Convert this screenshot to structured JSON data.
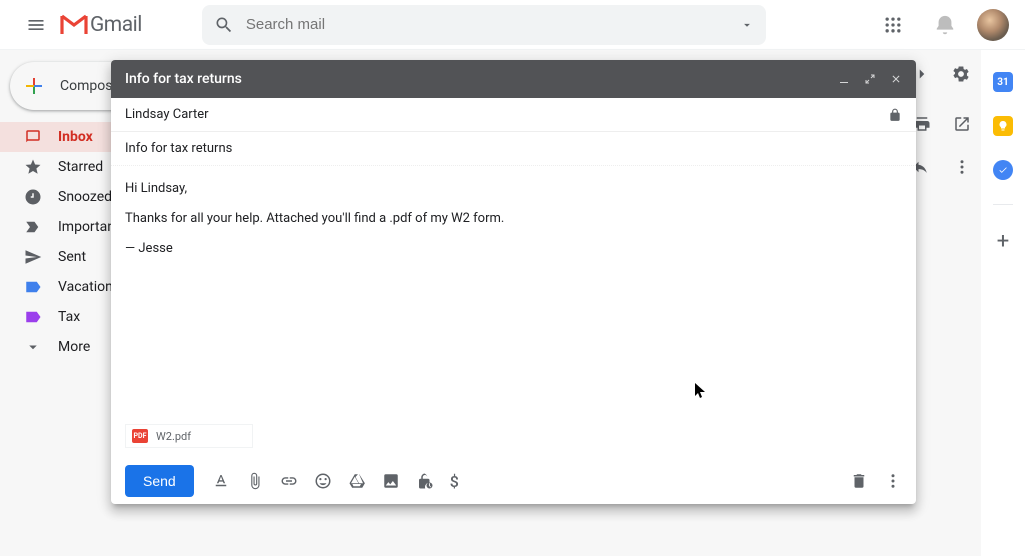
{
  "header": {
    "logo_text": "Gmail",
    "search_placeholder": "Search mail"
  },
  "sidebar": {
    "compose_label": "Compose",
    "items": [
      {
        "label": "Inbox"
      },
      {
        "label": "Starred"
      },
      {
        "label": "Snoozed"
      },
      {
        "label": "Important"
      },
      {
        "label": "Sent"
      },
      {
        "label": "Vacation"
      },
      {
        "label": "Tax"
      },
      {
        "label": "More"
      }
    ]
  },
  "side_panel": {
    "calendar_day": "31"
  },
  "compose": {
    "title": "Info for tax returns",
    "recipient": "Lindsay Carter",
    "subject": "Info for tax returns",
    "body_line1": "Hi Lindsay,",
    "body_line2": "Thanks for all your help. Attached you'll find a .pdf of my W2 form.",
    "signature": "— Jesse",
    "attachment": {
      "name": "W2.pdf",
      "badge": "PDF"
    },
    "send_label": "Send",
    "money_symbol": "$"
  }
}
